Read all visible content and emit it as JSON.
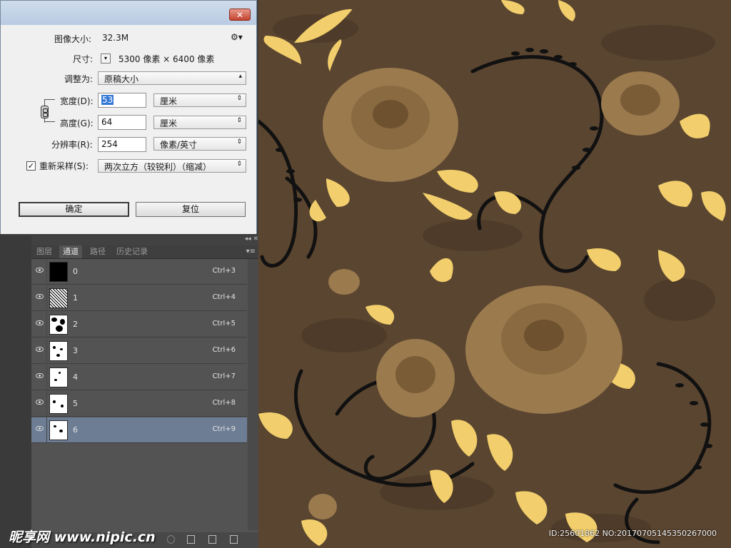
{
  "dialog": {
    "close_label": "✕",
    "image_size_label": "图像大小:",
    "image_size_value": "32.3M",
    "gear_label": "⚙▾",
    "dimensions_label": "尺寸:",
    "dimensions_value": "5300 像素 × 6400 像素",
    "fit_to_label": "调整为:",
    "fit_to_value": "原稿大小",
    "width_label": "宽度(D):",
    "width_value": "53",
    "width_unit": "厘米",
    "height_label": "高度(G):",
    "height_value": "64",
    "height_unit": "厘米",
    "resolution_label": "分辨率(R):",
    "resolution_value": "254",
    "resolution_unit": "像素/英寸",
    "resample_label": "重新采样(S):",
    "resample_checked": true,
    "resample_value": "两次立方（较锐利）（缩减）",
    "ok_label": "确定",
    "reset_label": "复位"
  },
  "panel": {
    "collapse": "◂◂ ✕",
    "menu": "▾≡",
    "tabs": [
      {
        "label": "图层",
        "active": false
      },
      {
        "label": "通道",
        "active": true
      },
      {
        "label": "路径",
        "active": false
      },
      {
        "label": "历史记录",
        "active": false
      }
    ],
    "channels": [
      {
        "name": "0",
        "shortcut": "Ctrl+3",
        "thumb": "black",
        "selected": false
      },
      {
        "name": "1",
        "shortcut": "Ctrl+4",
        "thumb": "noise",
        "selected": false
      },
      {
        "name": "2",
        "shortcut": "Ctrl+5",
        "thumb": "blobs",
        "selected": false
      },
      {
        "name": "3",
        "shortcut": "Ctrl+6",
        "thumb": "sparse",
        "selected": false
      },
      {
        "name": "4",
        "shortcut": "Ctrl+7",
        "thumb": "sparse",
        "selected": false
      },
      {
        "name": "5",
        "shortcut": "Ctrl+8",
        "thumb": "sparse",
        "selected": false
      },
      {
        "name": "6",
        "shortcut": "Ctrl+9",
        "thumb": "sparse",
        "selected": true
      }
    ]
  },
  "canvas": {
    "background_color": "#5a4530",
    "rose_color": "#9b7a4e",
    "leaf_color": "#f2cf6c",
    "vine_color": "#111111",
    "watermark_id": "ID:25601862 NO:20170705145350267000"
  },
  "site_watermark": "昵享网 www.nipic.cn"
}
